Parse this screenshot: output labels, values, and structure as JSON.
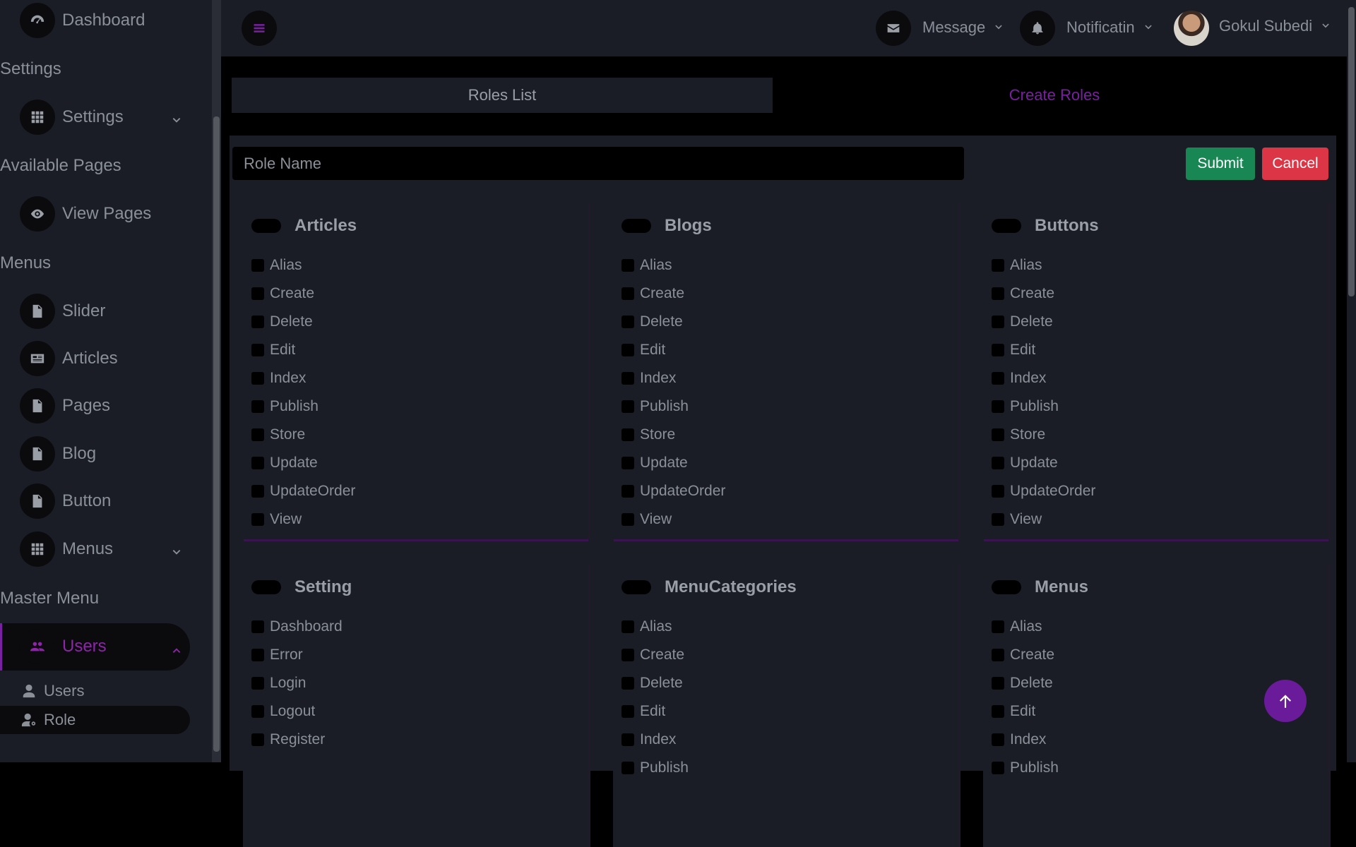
{
  "sidebar": {
    "dashboard": "Dashboard",
    "settings_heading": "Settings",
    "settings": "Settings",
    "pages_heading": "Available Pages",
    "view_pages": "View Pages",
    "menus_heading": "Menus",
    "slider": "Slider",
    "articles": "Articles",
    "pages": "Pages",
    "blog": "Blog",
    "button": "Button",
    "menus": "Menus",
    "master_heading": "Master Menu",
    "users_group": "Users",
    "users": "Users",
    "role": "Role"
  },
  "topbar": {
    "message": "Message",
    "notification": "Notificatin",
    "user_name": "Gokul Subedi"
  },
  "tabs": {
    "roles_list": "Roles List",
    "create_roles": "Create Roles"
  },
  "form": {
    "role_name_placeholder": "Role Name",
    "submit": "Submit",
    "cancel": "Cancel"
  },
  "permission_groups": [
    {
      "title": "Articles",
      "items": [
        "Alias",
        "Create",
        "Delete",
        "Edit",
        "Index",
        "Publish",
        "Store",
        "Update",
        "UpdateOrder",
        "View"
      ]
    },
    {
      "title": "Blogs",
      "items": [
        "Alias",
        "Create",
        "Delete",
        "Edit",
        "Index",
        "Publish",
        "Store",
        "Update",
        "UpdateOrder",
        "View"
      ]
    },
    {
      "title": "Buttons",
      "items": [
        "Alias",
        "Create",
        "Delete",
        "Edit",
        "Index",
        "Publish",
        "Store",
        "Update",
        "UpdateOrder",
        "View"
      ]
    },
    {
      "title": "Setting",
      "items": [
        "Dashboard",
        "Error",
        "Login",
        "Logout",
        "Register"
      ]
    },
    {
      "title": "MenuCategories",
      "items": [
        "Alias",
        "Create",
        "Delete",
        "Edit",
        "Index",
        "Publish"
      ]
    },
    {
      "title": "Menus",
      "items": [
        "Alias",
        "Create",
        "Delete",
        "Edit",
        "Index",
        "Publish"
      ]
    }
  ],
  "colors": {
    "accent": "#7b1fa2",
    "submit": "#198754",
    "cancel": "#dc3545",
    "panel": "#1a1d26"
  }
}
